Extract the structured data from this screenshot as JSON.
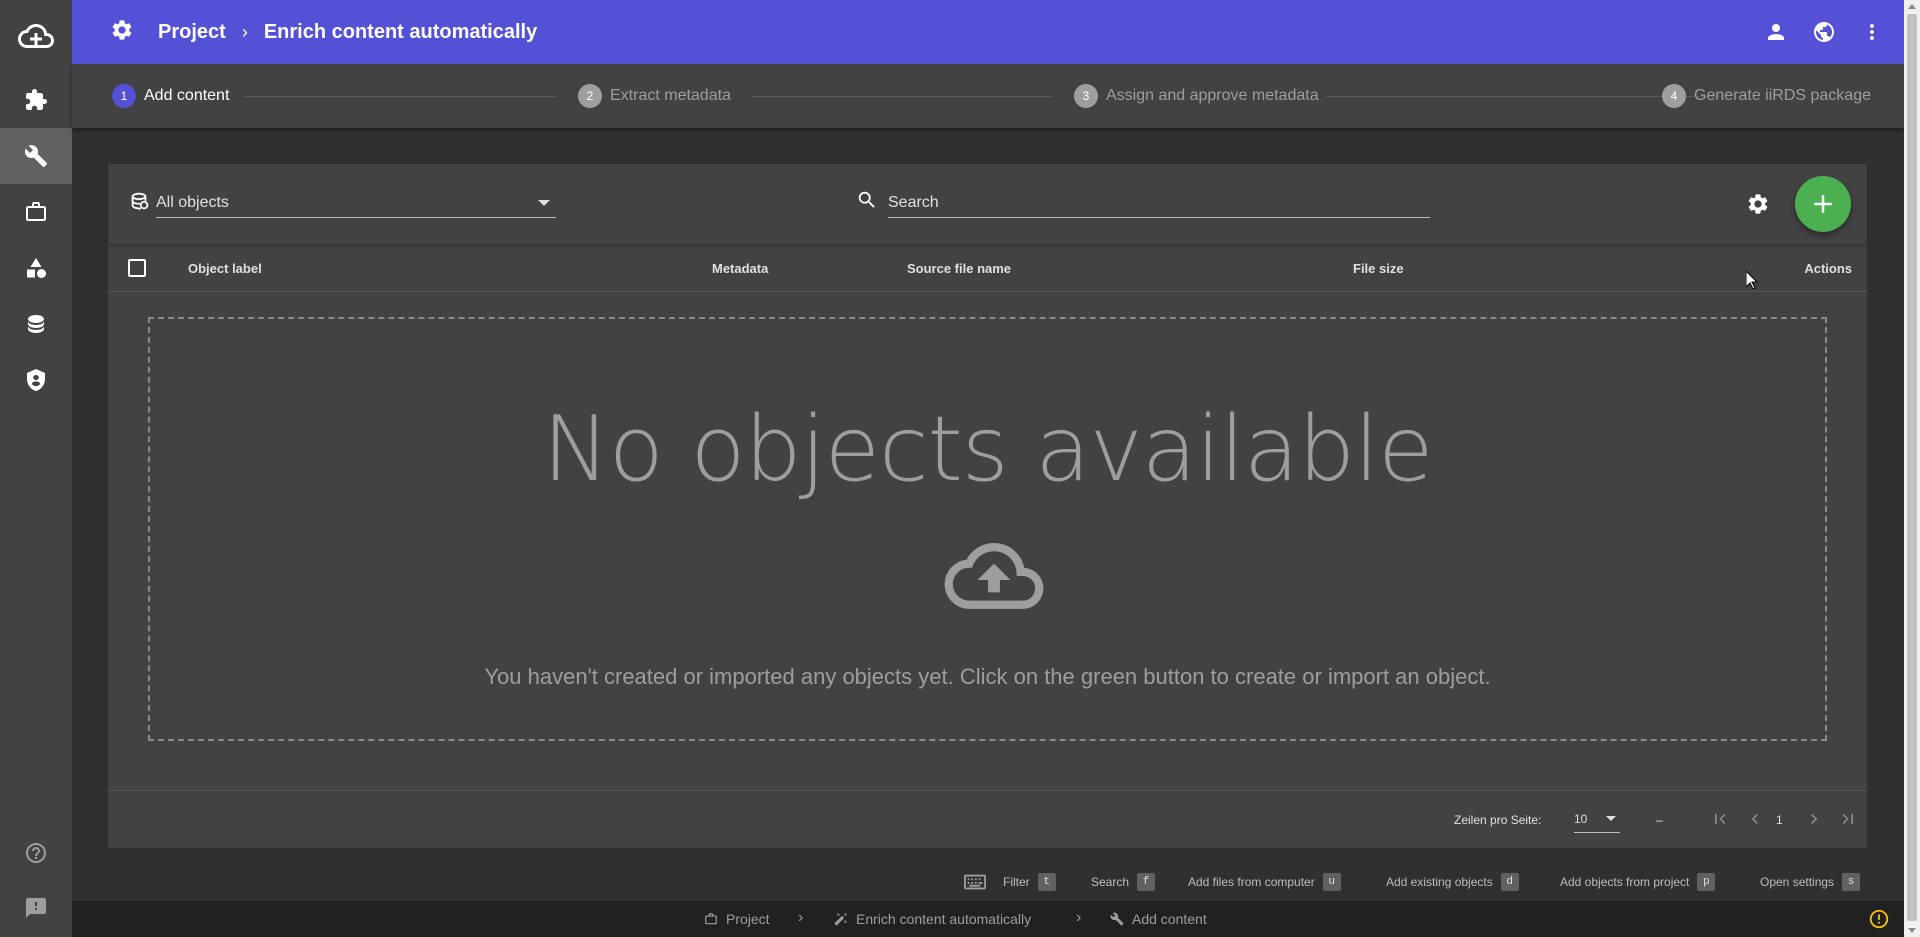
{
  "header": {
    "breadcrumb": [
      "Project",
      "Enrich content automatically"
    ],
    "separator": "›",
    "colors": {
      "primary": "#5451d6"
    }
  },
  "sidebar": {
    "items": [
      {
        "icon": "cloud-add-icon"
      },
      {
        "icon": "puzzle-icon"
      },
      {
        "icon": "wrench-icon",
        "active": true
      },
      {
        "icon": "briefcase-icon"
      },
      {
        "icon": "shapes-icon"
      },
      {
        "icon": "database-icon"
      },
      {
        "icon": "shield-icon"
      },
      {
        "icon": "help-icon"
      },
      {
        "icon": "feedback-icon"
      }
    ]
  },
  "stepper": {
    "steps": [
      {
        "num": "1",
        "label": "Add content",
        "active": true
      },
      {
        "num": "2",
        "label": "Extract metadata"
      },
      {
        "num": "3",
        "label": "Assign and approve metadata"
      },
      {
        "num": "4",
        "label": "Generate iiRDS package"
      }
    ]
  },
  "toolbar": {
    "filter_value": "All objects",
    "search_placeholder": "Search"
  },
  "table": {
    "columns": [
      "Object label",
      "Metadata",
      "Source file name",
      "File size",
      "Actions"
    ]
  },
  "empty": {
    "title": "No objects available",
    "message": "You haven't created or imported any objects yet. Click on the green button to create or import an object."
  },
  "pagination": {
    "rows_label": "Zeilen pro Seite:",
    "rows_value": "10",
    "range": "–",
    "page": "1"
  },
  "hints": [
    {
      "label": "Filter",
      "key": "t"
    },
    {
      "label": "Search",
      "key": "f"
    },
    {
      "label": "Add files from computer",
      "key": "u"
    },
    {
      "label": "Add existing objects",
      "key": "d"
    },
    {
      "label": "Add objects from project",
      "key": "p"
    },
    {
      "label": "Open settings",
      "key": "s"
    }
  ],
  "footer": {
    "breadcrumb": [
      "Project",
      "Enrich content automatically",
      "Add content"
    ],
    "separator": "›"
  }
}
